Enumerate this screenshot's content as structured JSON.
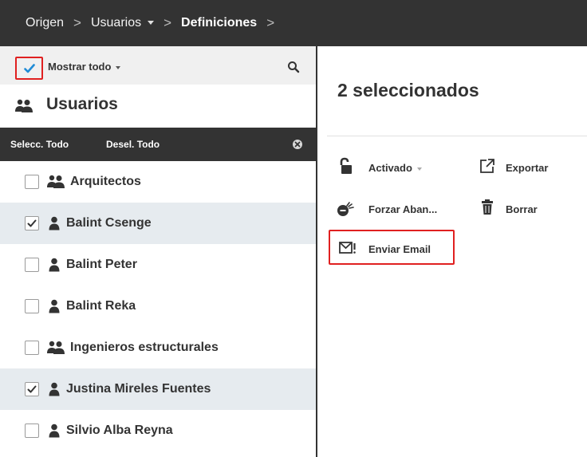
{
  "breadcrumb": {
    "items": [
      "Origen",
      "Usuarios",
      "Definiciones"
    ],
    "separator": ">"
  },
  "filter": {
    "label": "Mostrar todo"
  },
  "left_panel": {
    "title": "Usuarios",
    "select_all": "Selecc. Todo",
    "deselect_all": "Desel. Todo"
  },
  "users": [
    {
      "name": "Arquitectos",
      "type": "group",
      "checked": false
    },
    {
      "name": "Balint Csenge",
      "type": "user",
      "checked": true
    },
    {
      "name": "Balint Peter",
      "type": "user",
      "checked": false
    },
    {
      "name": "Balint Reka",
      "type": "user",
      "checked": false
    },
    {
      "name": "Ingenieros estructurales",
      "type": "group",
      "checked": false
    },
    {
      "name": "Justina Mireles Fuentes",
      "type": "user",
      "checked": true
    },
    {
      "name": "Silvio Alba Reyna",
      "type": "user",
      "checked": false
    }
  ],
  "right_panel": {
    "title": "2 seleccionados",
    "actions": {
      "activated": "Activado",
      "export": "Exportar",
      "force_logout": "Forzar Aban...",
      "delete": "Borrar",
      "send_email": "Enviar Email"
    }
  },
  "colors": {
    "dark_bar": "#333333",
    "highlight_red": "#e02020",
    "selected_row": "#e6ebef",
    "check_blue": "#1f8bd6"
  }
}
